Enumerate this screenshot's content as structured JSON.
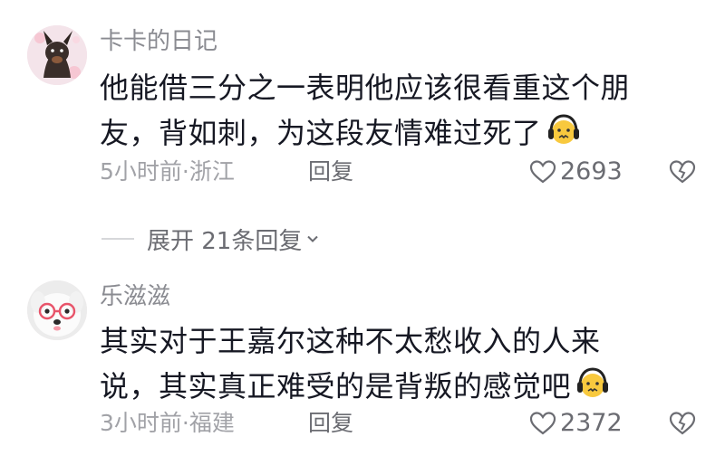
{
  "comments": [
    {
      "username": "卡卡的日记",
      "text_lines": [
        "他能借三分之一表明他应该很看重这个朋",
        "友，背如刺，为这段友情难过死了"
      ],
      "emoji": "grimace-headphones-emoji",
      "time_location": "5小时前·浙江",
      "reply_label": "回复",
      "likes": "2693",
      "avatar": "dog-avatar"
    },
    {
      "username": "乐滋滋",
      "text_lines": [
        "其实对于王嘉尔这种不太愁收入的人来",
        "说，其实真正难受的是背叛的感觉吧"
      ],
      "emoji": "grimace-headphones-emoji",
      "time_location": "3小时前·福建",
      "reply_label": "回复",
      "likes": "2372",
      "avatar": "white-dog-glasses-avatar"
    }
  ],
  "expand_replies": {
    "label": "展开 21条回复"
  },
  "colors": {
    "text": "#161823",
    "username": "#8a8b91",
    "meta": "#a1a2a7",
    "action": "#6b6c72"
  }
}
